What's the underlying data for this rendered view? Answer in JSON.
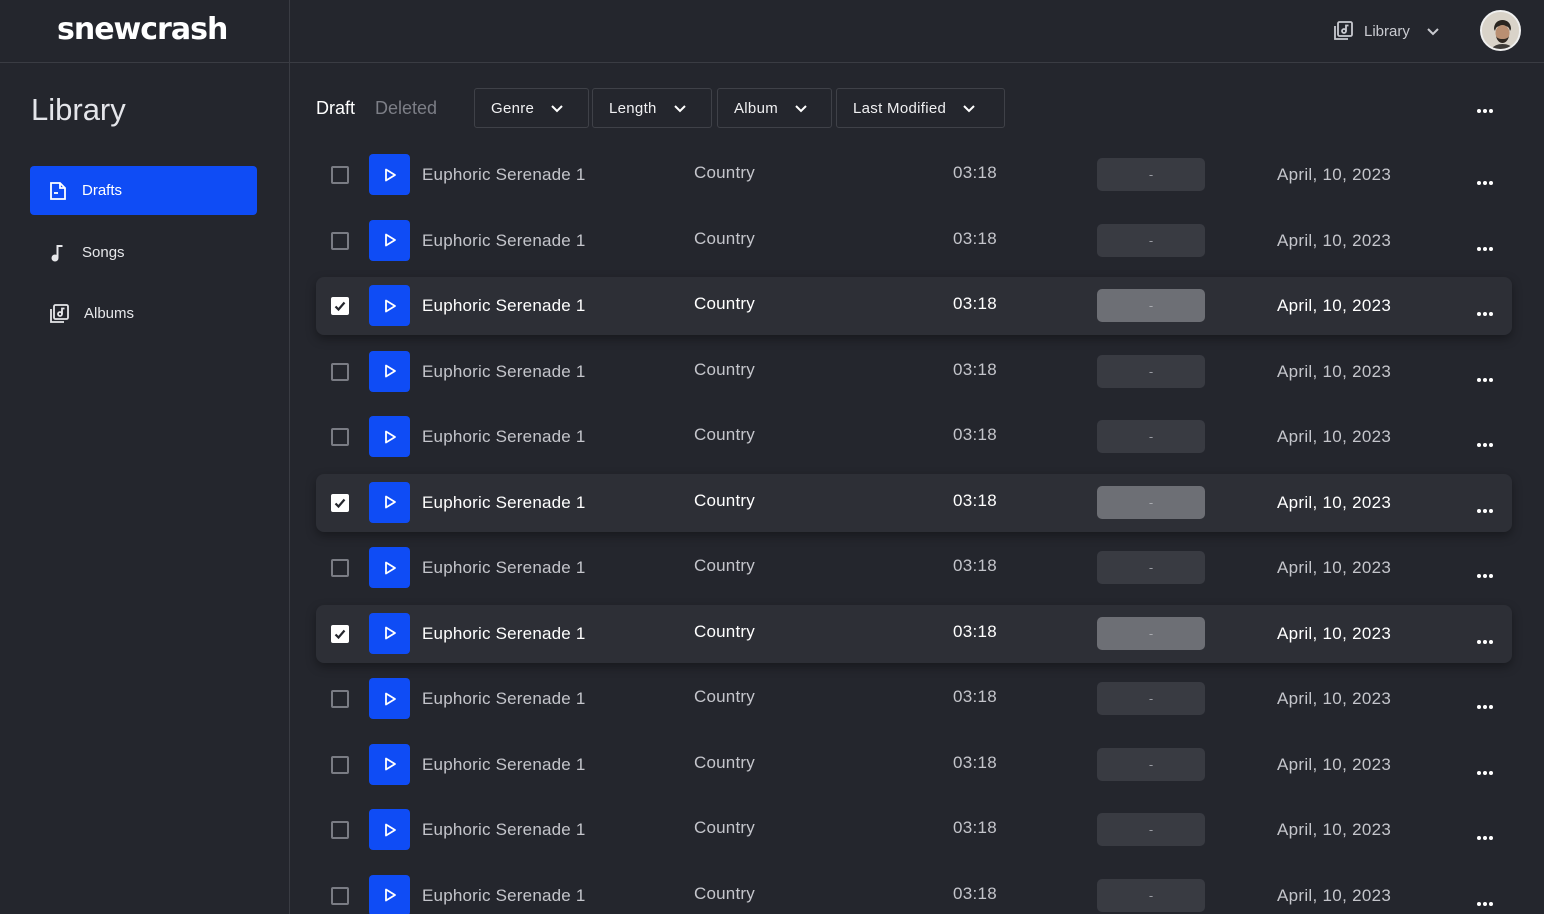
{
  "app": {
    "logo": "snewcrash"
  },
  "header": {
    "library_switch_label": "Library"
  },
  "sidebar": {
    "title": "Library",
    "items": [
      {
        "label": "Drafts",
        "icon": "drafts-icon",
        "active": true
      },
      {
        "label": "Songs",
        "icon": "music-note-icon",
        "active": false
      },
      {
        "label": "Albums",
        "icon": "albums-icon",
        "active": false
      }
    ]
  },
  "main": {
    "tabs": [
      {
        "label": "Draft",
        "active": true
      },
      {
        "label": "Deleted",
        "active": false
      }
    ],
    "filters": [
      {
        "label": "Genre"
      },
      {
        "label": "Length"
      },
      {
        "label": "Album"
      },
      {
        "label": "Last Modified"
      }
    ],
    "rows": [
      {
        "selected": false,
        "title": "Euphoric Serenade 1",
        "genre": "Country",
        "length": "03:18",
        "album": "-",
        "date": "April, 10, 2023"
      },
      {
        "selected": false,
        "title": "Euphoric Serenade 1",
        "genre": "Country",
        "length": "03:18",
        "album": "-",
        "date": "April, 10, 2023"
      },
      {
        "selected": true,
        "title": "Euphoric Serenade 1",
        "genre": "Country",
        "length": "03:18",
        "album": "-",
        "date": "April, 10, 2023"
      },
      {
        "selected": false,
        "title": "Euphoric Serenade 1",
        "genre": "Country",
        "length": "03:18",
        "album": "-",
        "date": "April, 10, 2023"
      },
      {
        "selected": false,
        "title": "Euphoric Serenade 1",
        "genre": "Country",
        "length": "03:18",
        "album": "-",
        "date": "April, 10, 2023"
      },
      {
        "selected": true,
        "title": "Euphoric Serenade 1",
        "genre": "Country",
        "length": "03:18",
        "album": "-",
        "date": "April, 10, 2023"
      },
      {
        "selected": false,
        "title": "Euphoric Serenade 1",
        "genre": "Country",
        "length": "03:18",
        "album": "-",
        "date": "April, 10, 2023"
      },
      {
        "selected": true,
        "title": "Euphoric Serenade 1",
        "genre": "Country",
        "length": "03:18",
        "album": "-",
        "date": "April, 10, 2023"
      },
      {
        "selected": false,
        "title": "Euphoric Serenade 1",
        "genre": "Country",
        "length": "03:18",
        "album": "-",
        "date": "April, 10, 2023"
      },
      {
        "selected": false,
        "title": "Euphoric Serenade 1",
        "genre": "Country",
        "length": "03:18",
        "album": "-",
        "date": "April, 10, 2023"
      },
      {
        "selected": false,
        "title": "Euphoric Serenade 1",
        "genre": "Country",
        "length": "03:18",
        "album": "-",
        "date": "April, 10, 2023"
      },
      {
        "selected": false,
        "title": "Euphoric Serenade 1",
        "genre": "Country",
        "length": "03:18",
        "album": "-",
        "date": "April, 10, 2023"
      }
    ]
  },
  "colors": {
    "background": "#24262d",
    "accent": "#0f4cf5",
    "divider": "#3a3c43",
    "muted_text": "#7c7e86"
  }
}
